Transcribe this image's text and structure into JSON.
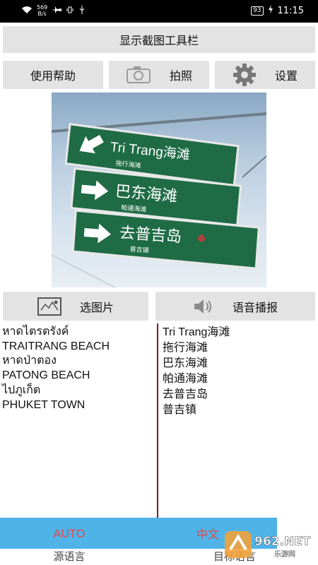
{
  "status_bar": {
    "speed_value": "569",
    "speed_unit": "B/s",
    "battery": "93",
    "time": "11:15"
  },
  "toolbar": {
    "show_toolbar_label": "显示截图工具栏"
  },
  "actions": {
    "help_label": "使用帮助",
    "photo_label": "拍照",
    "settings_label": "设置"
  },
  "photo_signs": [
    {
      "main": "Tri Trang海滩",
      "sub": "拖行海滩"
    },
    {
      "main": "巴东海滩",
      "sub": "帕通海滩"
    },
    {
      "main": "去普吉岛",
      "sub": "普吉镇"
    }
  ],
  "media": {
    "pick_image_label": "选图片",
    "speak_label": "语音播报"
  },
  "source_lines": [
    "หาดไตรตรังค์",
    "TRAITRANG BEACH",
    "หาดป่าตอง",
    "PATONG BEACH",
    "ไปภูเก็ต",
    "PHUKET TOWN"
  ],
  "translated_lines": [
    "Tri Trang海滩",
    "拖行海滩",
    "巴东海滩",
    "帕通海滩",
    "去普吉岛",
    "普吉镇"
  ],
  "language_bar": {
    "source_value": "AUTO",
    "target_value": "中文",
    "source_caption": "源语言",
    "target_caption": "目标语言"
  },
  "watermark": {
    "text": "962.NET",
    "sub": "乐游网"
  },
  "colors": {
    "accent_blue": "#4fb3e8",
    "lang_red": "#e34a4a",
    "divider": "#7a1f2a",
    "sign_green": "#1f6b45"
  }
}
